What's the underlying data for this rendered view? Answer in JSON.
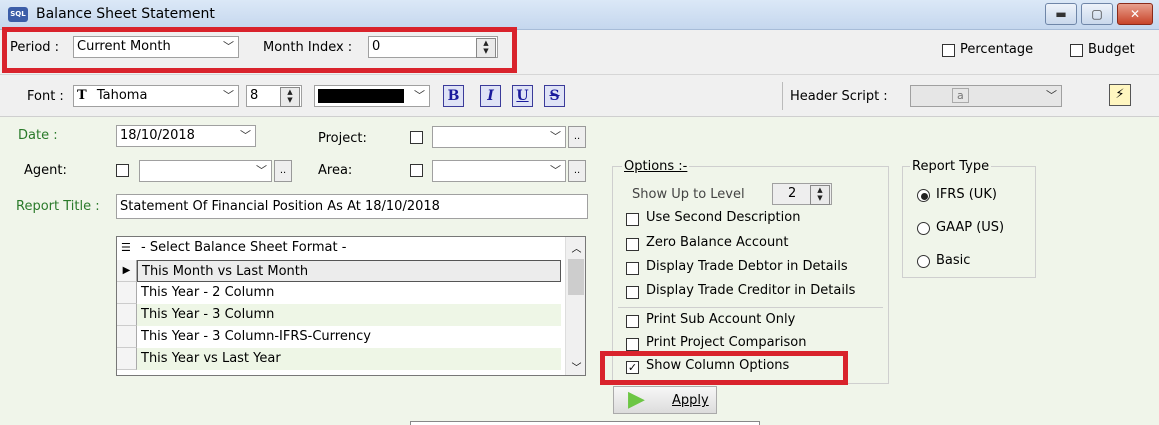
{
  "window": {
    "app_icon_text": "SQL",
    "title": "Balance Sheet Statement",
    "min_glyph": "▬",
    "max_glyph": "▢",
    "close_glyph": "✕"
  },
  "toolbar1": {
    "period_label": "Period :",
    "period_value": "Current Month",
    "month_index_label": "Month Index :",
    "month_index_value": "0",
    "percentage_label": "Percentage",
    "budget_label": "Budget"
  },
  "toolbar2": {
    "font_label": "Font :",
    "font_icon_glyph": "T",
    "font_value": "Tahoma",
    "font_size": "8",
    "bold": "B",
    "italic": "I",
    "underline": "U",
    "strike": "S",
    "header_script_label": "Header Script :",
    "header_script_value": "a",
    "lightning_glyph": "⚡"
  },
  "form": {
    "date_label": "Date :",
    "date_value": "18/10/2018",
    "project_label": "Project:",
    "agent_label": "Agent:",
    "area_label": "Area:",
    "ellipsis": "..",
    "report_title_label": "Report Title :",
    "report_title_value": "Statement Of Financial Position As At 18/10/2018"
  },
  "format_list": {
    "header_icon": "☰",
    "header": "- Select Balance Sheet Format -",
    "rows": [
      "This Month vs Last Month",
      "This Year - 2 Column",
      "This Year - 3 Column",
      "This Year - 3 Column-IFRS-Currency",
      "This Year vs Last Year"
    ],
    "selected_marker": "▶"
  },
  "options": {
    "title": "Options :-",
    "show_up_to_level_label": "Show Up to Level",
    "show_up_to_level_value": "2",
    "items": [
      {
        "label": "Use Second Description",
        "checked": false
      },
      {
        "label": "Zero Balance Account",
        "checked": false
      },
      {
        "label": "Display Trade Debtor in Details",
        "checked": false
      },
      {
        "label": "Display Trade Creditor in Details",
        "checked": false
      },
      {
        "label": "Print Sub Account Only",
        "checked": false
      },
      {
        "label": "Print Project Comparison",
        "checked": false
      },
      {
        "label": "Show Column Options",
        "checked": true
      }
    ],
    "check_glyph": "✓"
  },
  "report_type": {
    "title": "Report Type",
    "options": [
      {
        "label": "IFRS (UK)",
        "selected": true
      },
      {
        "label": "GAAP (US)",
        "selected": false
      },
      {
        "label": "Basic",
        "selected": false
      }
    ]
  },
  "apply": {
    "label": "Apply",
    "icon_glyph": "▶"
  },
  "colors": {
    "highlight_red": "#d9232c",
    "label_green": "#2a7a2a",
    "form_bg": "#f0f5ea"
  }
}
